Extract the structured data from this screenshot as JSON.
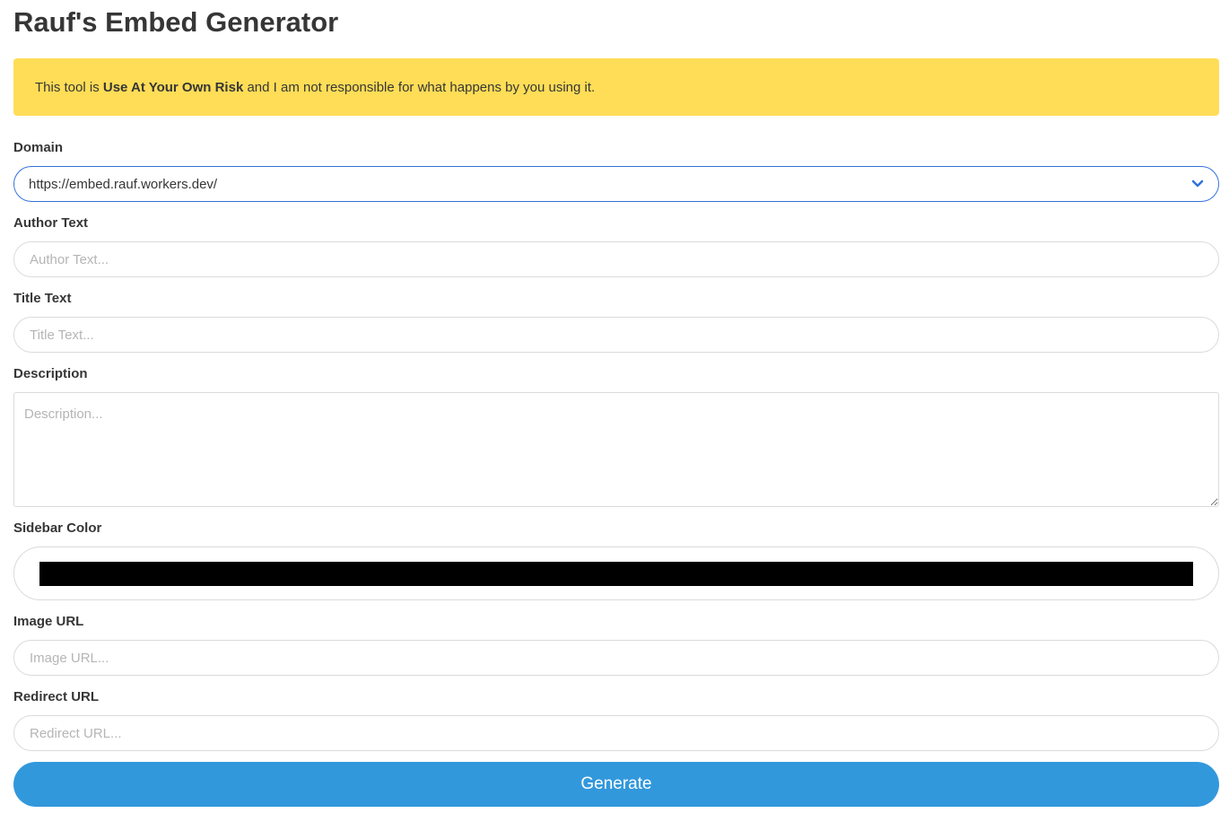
{
  "page": {
    "title": "Rauf's Embed Generator"
  },
  "notice": {
    "prefix": "This tool is ",
    "emphasis": "Use At Your Own Risk",
    "suffix": " and I am not responsible for what happens by you using it.",
    "color": "#ffdd57"
  },
  "form": {
    "domain": {
      "label": "Domain",
      "selected": "https://embed.rauf.workers.dev/",
      "icon": "chevron-down-icon"
    },
    "author": {
      "label": "Author Text",
      "placeholder": "Author Text...",
      "value": ""
    },
    "title": {
      "label": "Title Text",
      "placeholder": "Title Text...",
      "value": ""
    },
    "description": {
      "label": "Description",
      "placeholder": "Description...",
      "value": ""
    },
    "sidebar_color": {
      "label": "Sidebar Color",
      "value": "#000000"
    },
    "image_url": {
      "label": "Image URL",
      "placeholder": "Image URL...",
      "value": ""
    },
    "redirect_url": {
      "label": "Redirect URL",
      "placeholder": "Redirect URL...",
      "value": ""
    },
    "submit_label": "Generate"
  },
  "colors": {
    "accent": "#3298dc",
    "focus_border": "#3273dc"
  }
}
